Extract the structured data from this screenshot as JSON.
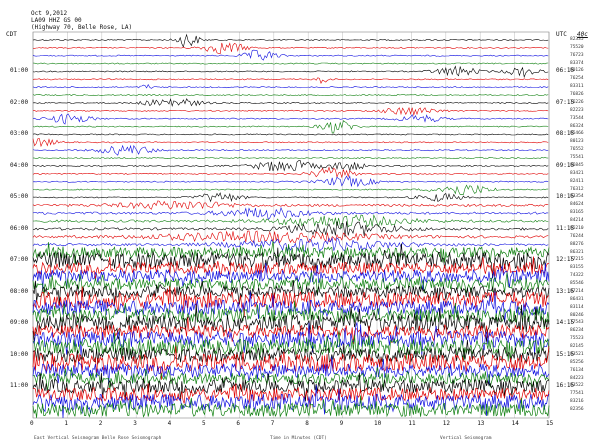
{
  "header": {
    "date": "Oct 9,2012",
    "station": "LA09 HHZ GS 00",
    "location": "(Highway 70, Belle Rose, LA)"
  },
  "corners": {
    "left": "CDT",
    "right": "UTC",
    "scale": "40c"
  },
  "left_times": [
    "01:00",
    "02:00",
    "03:00",
    "04:00",
    "05:00",
    "06:00",
    "07:00",
    "08:00",
    "09:00",
    "10:00",
    "11:00"
  ],
  "right_times": [
    "06:15",
    "07:15",
    "08:15",
    "09:15",
    "10:15",
    "11:15",
    "12:15",
    "13:15",
    "14:15",
    "15:15",
    "16:15"
  ],
  "right_counts": [
    "82335",
    "75520",
    "76723",
    "83374",
    "80126",
    "76254",
    "83311",
    "76826",
    "76226",
    "82223",
    "73544",
    "86324",
    "85466",
    "80123",
    "76552",
    "75541",
    "86845",
    "83421",
    "82411",
    "76312",
    "83354",
    "84624",
    "83165",
    "84214",
    "85210",
    "76244",
    "88276",
    "86321",
    "77215",
    "83155",
    "74322",
    "85546",
    "87214",
    "86431",
    "83114",
    "80246",
    "77543",
    "86234",
    "75523",
    "82145",
    "83521",
    "85256",
    "76134",
    "84223",
    "83522",
    "77541",
    "83216",
    "82356"
  ],
  "x_ticks": [
    "0",
    "1",
    "2",
    "3",
    "4",
    "5",
    "6",
    "7",
    "8",
    "9",
    "10",
    "11",
    "12",
    "13",
    "14",
    "15"
  ],
  "footer": {
    "left": "East Vertical Seismogram    Belle Rose Seismograph",
    "center": "Time in Minutes (CDT)",
    "right": "Vertical Seismogram"
  },
  "trace_colors": [
    "#000000",
    "#e00000",
    "#1010e0",
    "#108010"
  ]
}
